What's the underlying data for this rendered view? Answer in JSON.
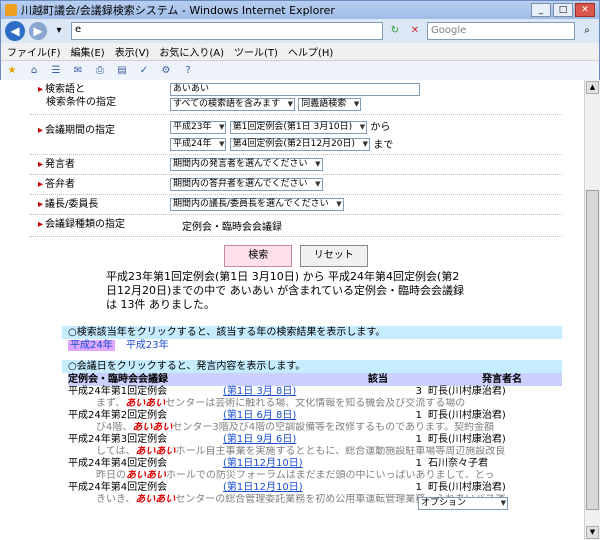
{
  "window": {
    "title": "川越町議会/会議録検索システム - Windows Internet Explorer"
  },
  "addressbar": {
    "url": "e",
    "search_placeholder": "Google"
  },
  "menu": [
    "ファイル(F)",
    "編集(E)",
    "表示(V)",
    "お気に入り(A)",
    "ツール(T)",
    "ヘルプ(H)"
  ],
  "form": {
    "keyword_label_1": "検索語と",
    "keyword_label_2": "検索条件の指定",
    "keyword_value": "あいあい",
    "cond_1": "すべての検索語を含みます",
    "cond_2": "同義語検索",
    "period_label": "会議期間の指定",
    "from_year": "平成23年",
    "from_session": "第1回定例会(第1日 3月10日)",
    "from_suffix": "から",
    "to_year": "平成24年",
    "to_session": "第4回定例会(第2日12月20日)",
    "to_suffix": "まで",
    "speaker_label": "発言者",
    "speaker_value": "期間内の発言者を選んでください",
    "answerer_label": "答弁者",
    "answerer_value": "期間内の答弁者を選んでください",
    "chair_label": "議長/委員長",
    "chair_value": "期間内の議長/委員長を選んでください",
    "type_label": "会議録種類の指定",
    "type_value": "定例会・臨時会会議録"
  },
  "buttons": {
    "search": "検索",
    "reset": "リセット"
  },
  "summary": {
    "line1": "平成23年第1回定例会(第1日 3月10日)  から  平成24年第4回定例会(第2",
    "line2": "日12月20日)までの中で  あいあい  が含まれている定例会・臨時会会議録",
    "line3": "は  13件  ありました。"
  },
  "year_info": "○検索該当年をクリックすると、該当する年の検索結果を表示します。",
  "years": [
    "平成24年",
    "平成23年"
  ],
  "date_info": "○会議日をクリックすると、発言内容を表示します。",
  "table_head": {
    "col1": "定例会・臨時会会議録",
    "col2": "該当",
    "col3": "発言者名"
  },
  "records": [
    {
      "meeting": "平成24年第1回定例会",
      "date": "(第1日 3月 8日)",
      "count": "3",
      "speaker": "町長(川村康治君)",
      "pre": "まず、",
      "hit": "あいあい",
      "post": "センターは芸術に触れる場、文化情報を知る機会及び交流する場の"
    },
    {
      "meeting": "平成24年第2回定例会",
      "date": "(第1日 6月 8日)",
      "count": "1",
      "speaker": "町長(川村康治君)",
      "pre": "び4階、",
      "hit": "あいあい",
      "post": "センター3階及び4階の空調設備等を改修するものであります。契約金額"
    },
    {
      "meeting": "平成24年第3回定例会",
      "date": "(第1日 9月 6日)",
      "count": "1",
      "speaker": "町長(川村康治君)",
      "pre": "しては、",
      "hit": "あいあい",
      "post": "ホール自主事業を実施するとともに、総合運動施設駐車場等周辺施設改良"
    },
    {
      "meeting": "平成24年第4回定例会",
      "date": "(第1日12月10日)",
      "count": "1",
      "speaker": "石川奈々子君",
      "pre": "昨日の",
      "hit": "あいあい",
      "post": "ホールでの防災フォーラムはまだまだ頭の中にいっぱいありまして、とっ"
    },
    {
      "meeting": "平成24年第4回定例会",
      "date": "(第1日12月10日)",
      "count": "1",
      "speaker": "町長(川村康治君)",
      "pre": "きいき、",
      "hit": "あいあい",
      "post": "センターの総合管理委託業務を初め公用車運転管理業務、ふれあいバス運"
    }
  ],
  "option_select": "オプション"
}
